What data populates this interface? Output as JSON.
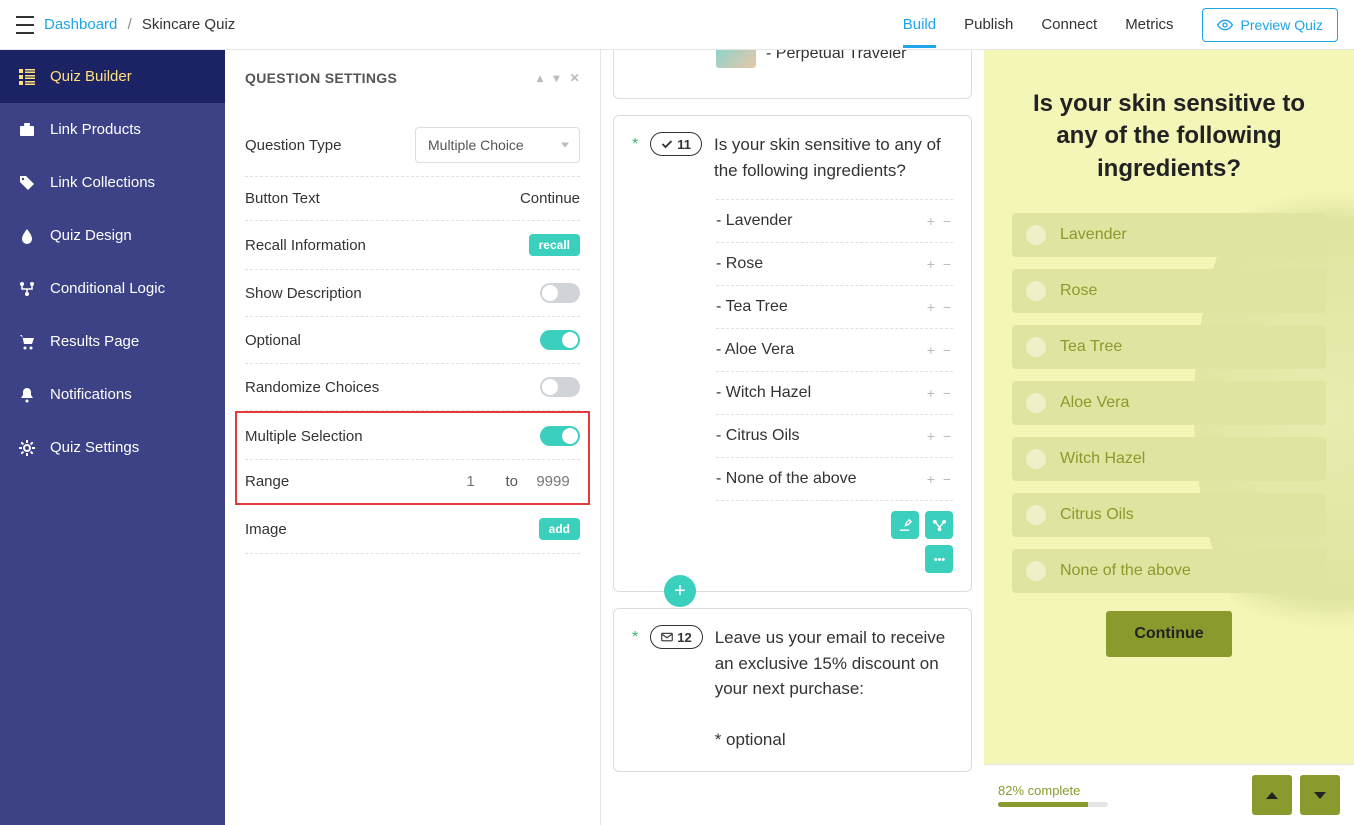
{
  "breadcrumb": {
    "root": "Dashboard",
    "current": "Skincare Quiz"
  },
  "topnav": {
    "build": "Build",
    "publish": "Publish",
    "connect": "Connect",
    "metrics": "Metrics",
    "preview": "Preview Quiz"
  },
  "sidebar": {
    "items": [
      {
        "label": "Quiz Builder"
      },
      {
        "label": "Link Products"
      },
      {
        "label": "Link Collections"
      },
      {
        "label": "Quiz Design"
      },
      {
        "label": "Conditional Logic"
      },
      {
        "label": "Results Page"
      },
      {
        "label": "Notifications"
      },
      {
        "label": "Quiz Settings"
      }
    ]
  },
  "settings": {
    "header": "QUESTION SETTINGS",
    "question_type_label": "Question Type",
    "question_type_value": "Multiple Choice",
    "button_text_label": "Button Text",
    "button_text_value": "Continue",
    "recall_label": "Recall Information",
    "recall_btn": "recall",
    "show_description_label": "Show Description",
    "optional_label": "Optional",
    "randomize_label": "Randomize Choices",
    "multiple_selection_label": "Multiple Selection",
    "range_label": "Range",
    "range_from_placeholder": "1",
    "range_to_word": "to",
    "range_to_placeholder": "9999",
    "image_label": "Image",
    "image_btn": "add"
  },
  "canvas": {
    "traveler_choice": "- Perpetual Traveler",
    "q11": {
      "num": "11",
      "text": "Is your skin sensitive to any of the following ingredients?",
      "choices": [
        "- Lavender",
        "- Rose",
        "- Tea Tree",
        "- Aloe Vera",
        "- Witch Hazel",
        "- Citrus Oils",
        "- None of the above"
      ]
    },
    "q12": {
      "num": "12",
      "text": "Leave us your email to receive an exclusive 15% discount on your next purchase:",
      "optional": "* optional"
    }
  },
  "preview": {
    "title": "Is your skin sensitive to any of the following ingredients?",
    "choices": [
      "Lavender",
      "Rose",
      "Tea Tree",
      "Aloe Vera",
      "Witch Hazel",
      "Citrus Oils",
      "None of the above"
    ],
    "continue": "Continue",
    "progress_text": "82% complete",
    "progress_pct": 82
  }
}
